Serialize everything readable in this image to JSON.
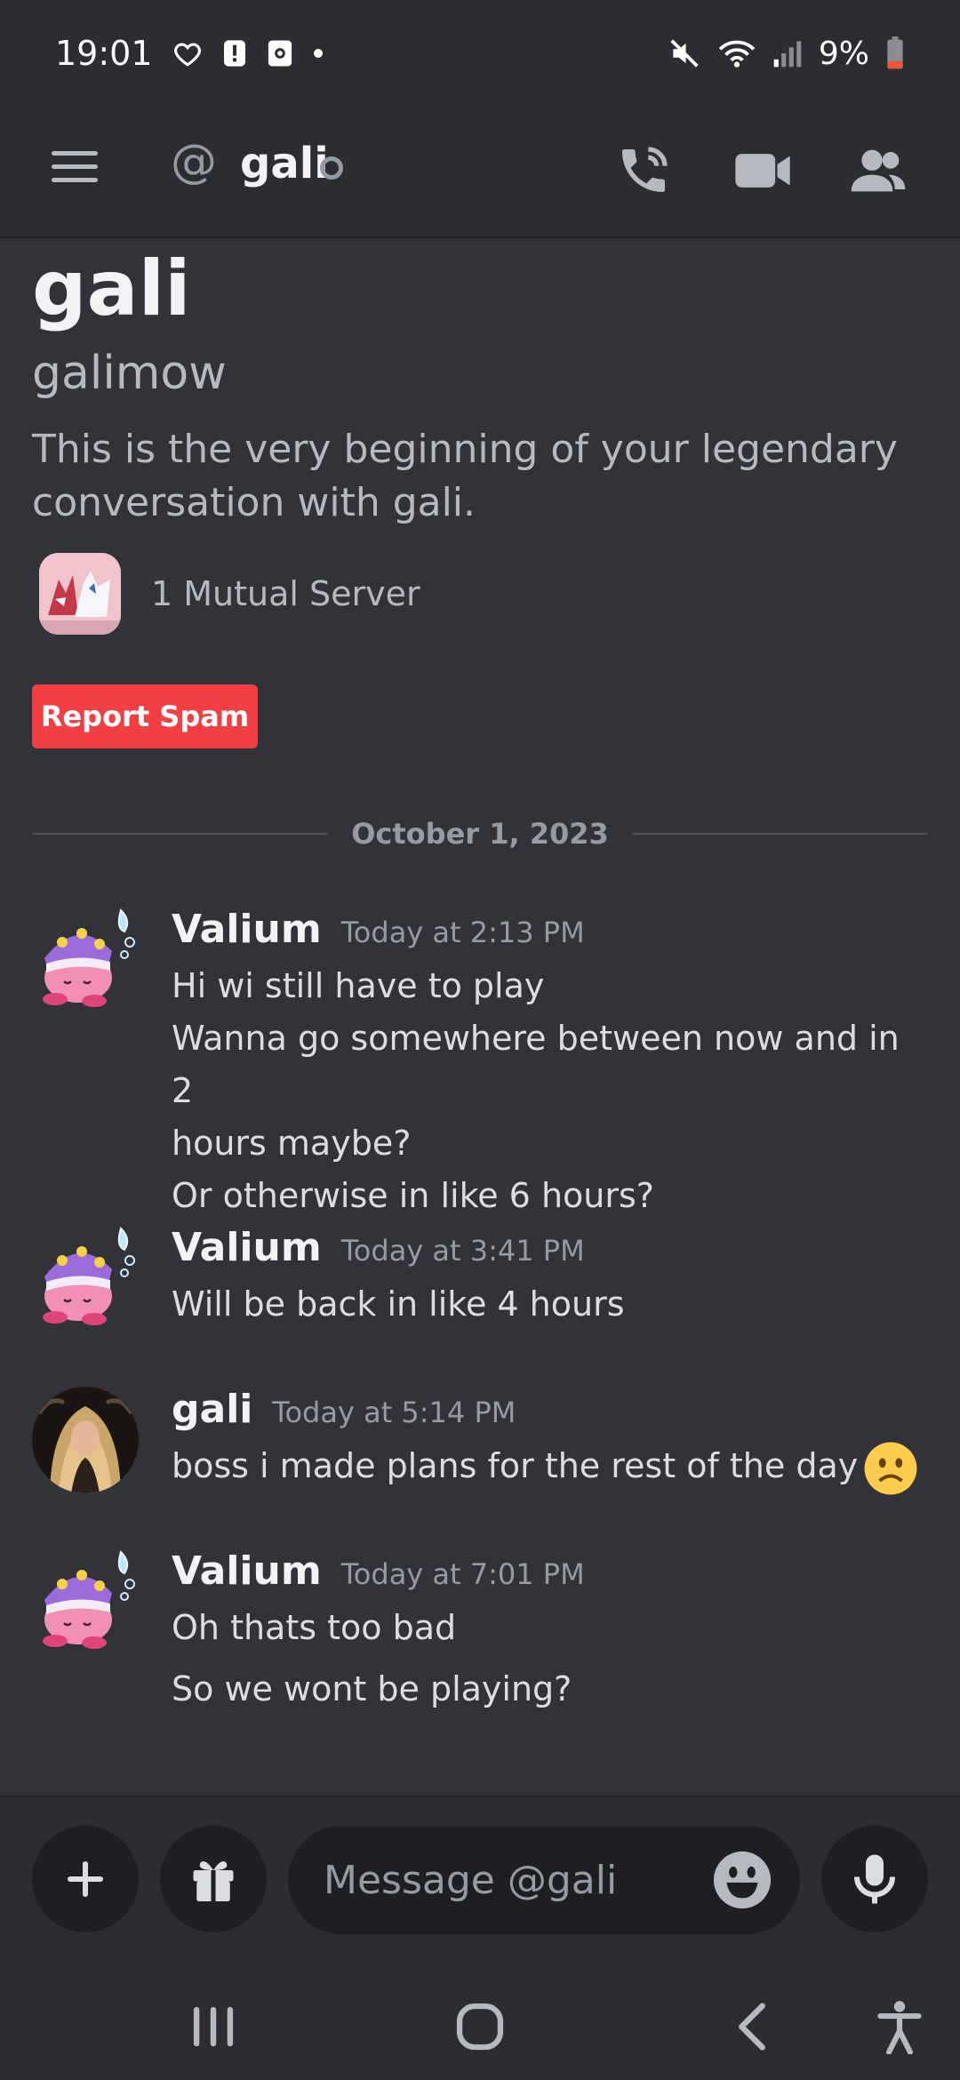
{
  "status_bar": {
    "time": "19:01",
    "battery": "9%",
    "icons": [
      "heart-hand-icon",
      "alert-icon",
      "screen-record-icon",
      "dot-icon",
      "mute-icon",
      "wifi-icon",
      "signal-icon",
      "battery-icon"
    ]
  },
  "header": {
    "at_symbol": "@",
    "title": "gali",
    "status": "offline",
    "actions": [
      "call-icon",
      "video-icon",
      "members-icon"
    ]
  },
  "intro": {
    "name": "gali",
    "handle": "galimow",
    "description": "This is the very beginning of your legendary conversation with gali.",
    "mutual_servers": "1 Mutual Server",
    "report_button": "Report Spam"
  },
  "date_divider": "October 1, 2023",
  "messages": [
    {
      "author": "Valium",
      "timestamp": "Today at 2:13 PM",
      "lines": [
        "Hi wi still have to play",
        "Wanna go somewhere between now and in 2",
        "hours maybe?",
        "Or otherwise in like 6 hours?"
      ]
    },
    {
      "author": "Valium",
      "timestamp": "Today at 3:41 PM",
      "lines": [
        "Will be back in like 4 hours"
      ]
    },
    {
      "author": "gali",
      "timestamp": "Today at 5:14 PM",
      "lines": [
        "boss i made plans for the rest of the day"
      ]
    },
    {
      "author": "Valium",
      "timestamp": "Today at 7:01 PM",
      "lines": [
        "Oh thats too bad",
        "So we wont be playing?"
      ]
    }
  ],
  "composer": {
    "placeholder": "Message @gali"
  },
  "colors": {
    "background": "#313338",
    "header": "#2b2d31",
    "danger": "#f23f43",
    "input": "#1e1f22"
  }
}
